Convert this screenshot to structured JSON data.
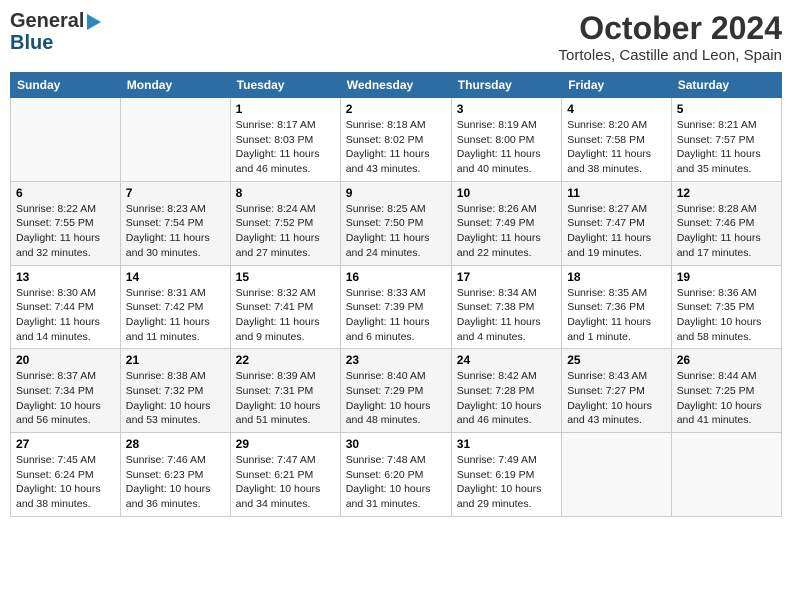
{
  "header": {
    "logo_general": "General",
    "logo_blue": "Blue",
    "month": "October 2024",
    "location": "Tortoles, Castille and Leon, Spain"
  },
  "weekdays": [
    "Sunday",
    "Monday",
    "Tuesday",
    "Wednesday",
    "Thursday",
    "Friday",
    "Saturday"
  ],
  "weeks": [
    [
      {
        "day": "",
        "info": ""
      },
      {
        "day": "",
        "info": ""
      },
      {
        "day": "1",
        "info": "Sunrise: 8:17 AM\nSunset: 8:03 PM\nDaylight: 11 hours and 46 minutes."
      },
      {
        "day": "2",
        "info": "Sunrise: 8:18 AM\nSunset: 8:02 PM\nDaylight: 11 hours and 43 minutes."
      },
      {
        "day": "3",
        "info": "Sunrise: 8:19 AM\nSunset: 8:00 PM\nDaylight: 11 hours and 40 minutes."
      },
      {
        "day": "4",
        "info": "Sunrise: 8:20 AM\nSunset: 7:58 PM\nDaylight: 11 hours and 38 minutes."
      },
      {
        "day": "5",
        "info": "Sunrise: 8:21 AM\nSunset: 7:57 PM\nDaylight: 11 hours and 35 minutes."
      }
    ],
    [
      {
        "day": "6",
        "info": "Sunrise: 8:22 AM\nSunset: 7:55 PM\nDaylight: 11 hours and 32 minutes."
      },
      {
        "day": "7",
        "info": "Sunrise: 8:23 AM\nSunset: 7:54 PM\nDaylight: 11 hours and 30 minutes."
      },
      {
        "day": "8",
        "info": "Sunrise: 8:24 AM\nSunset: 7:52 PM\nDaylight: 11 hours and 27 minutes."
      },
      {
        "day": "9",
        "info": "Sunrise: 8:25 AM\nSunset: 7:50 PM\nDaylight: 11 hours and 24 minutes."
      },
      {
        "day": "10",
        "info": "Sunrise: 8:26 AM\nSunset: 7:49 PM\nDaylight: 11 hours and 22 minutes."
      },
      {
        "day": "11",
        "info": "Sunrise: 8:27 AM\nSunset: 7:47 PM\nDaylight: 11 hours and 19 minutes."
      },
      {
        "day": "12",
        "info": "Sunrise: 8:28 AM\nSunset: 7:46 PM\nDaylight: 11 hours and 17 minutes."
      }
    ],
    [
      {
        "day": "13",
        "info": "Sunrise: 8:30 AM\nSunset: 7:44 PM\nDaylight: 11 hours and 14 minutes."
      },
      {
        "day": "14",
        "info": "Sunrise: 8:31 AM\nSunset: 7:42 PM\nDaylight: 11 hours and 11 minutes."
      },
      {
        "day": "15",
        "info": "Sunrise: 8:32 AM\nSunset: 7:41 PM\nDaylight: 11 hours and 9 minutes."
      },
      {
        "day": "16",
        "info": "Sunrise: 8:33 AM\nSunset: 7:39 PM\nDaylight: 11 hours and 6 minutes."
      },
      {
        "day": "17",
        "info": "Sunrise: 8:34 AM\nSunset: 7:38 PM\nDaylight: 11 hours and 4 minutes."
      },
      {
        "day": "18",
        "info": "Sunrise: 8:35 AM\nSunset: 7:36 PM\nDaylight: 11 hours and 1 minute."
      },
      {
        "day": "19",
        "info": "Sunrise: 8:36 AM\nSunset: 7:35 PM\nDaylight: 10 hours and 58 minutes."
      }
    ],
    [
      {
        "day": "20",
        "info": "Sunrise: 8:37 AM\nSunset: 7:34 PM\nDaylight: 10 hours and 56 minutes."
      },
      {
        "day": "21",
        "info": "Sunrise: 8:38 AM\nSunset: 7:32 PM\nDaylight: 10 hours and 53 minutes."
      },
      {
        "day": "22",
        "info": "Sunrise: 8:39 AM\nSunset: 7:31 PM\nDaylight: 10 hours and 51 minutes."
      },
      {
        "day": "23",
        "info": "Sunrise: 8:40 AM\nSunset: 7:29 PM\nDaylight: 10 hours and 48 minutes."
      },
      {
        "day": "24",
        "info": "Sunrise: 8:42 AM\nSunset: 7:28 PM\nDaylight: 10 hours and 46 minutes."
      },
      {
        "day": "25",
        "info": "Sunrise: 8:43 AM\nSunset: 7:27 PM\nDaylight: 10 hours and 43 minutes."
      },
      {
        "day": "26",
        "info": "Sunrise: 8:44 AM\nSunset: 7:25 PM\nDaylight: 10 hours and 41 minutes."
      }
    ],
    [
      {
        "day": "27",
        "info": "Sunrise: 7:45 AM\nSunset: 6:24 PM\nDaylight: 10 hours and 38 minutes."
      },
      {
        "day": "28",
        "info": "Sunrise: 7:46 AM\nSunset: 6:23 PM\nDaylight: 10 hours and 36 minutes."
      },
      {
        "day": "29",
        "info": "Sunrise: 7:47 AM\nSunset: 6:21 PM\nDaylight: 10 hours and 34 minutes."
      },
      {
        "day": "30",
        "info": "Sunrise: 7:48 AM\nSunset: 6:20 PM\nDaylight: 10 hours and 31 minutes."
      },
      {
        "day": "31",
        "info": "Sunrise: 7:49 AM\nSunset: 6:19 PM\nDaylight: 10 hours and 29 minutes."
      },
      {
        "day": "",
        "info": ""
      },
      {
        "day": "",
        "info": ""
      }
    ]
  ]
}
